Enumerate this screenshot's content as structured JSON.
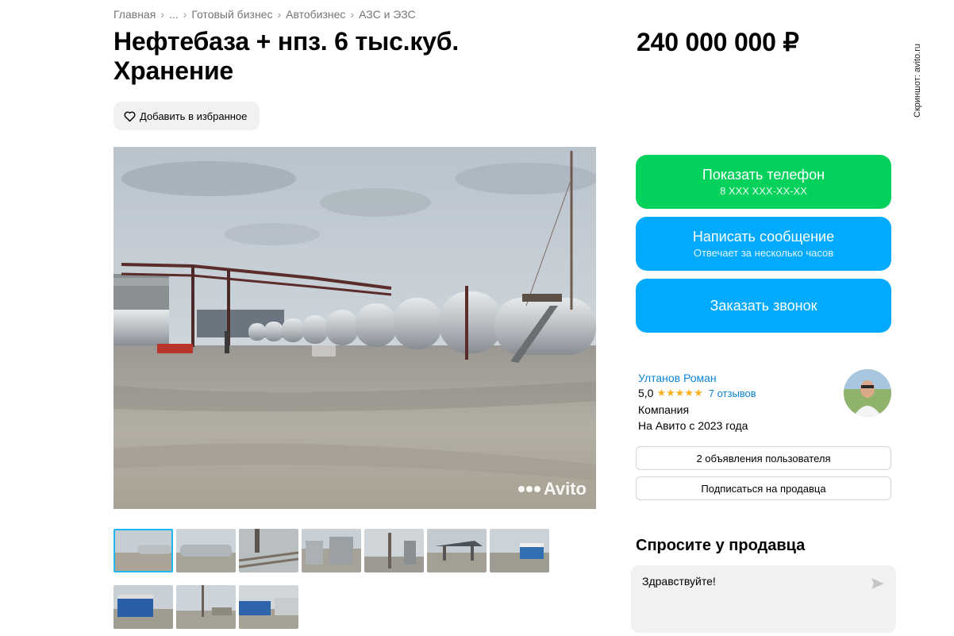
{
  "breadcrumb": {
    "items": [
      "Главная",
      "...",
      "Готовый бизнес",
      "Автобизнес",
      "АЗС и ЭЗС"
    ],
    "separator": "›"
  },
  "listing": {
    "title": "Нефтебаза + нпз. 6 тыс.куб. Хранение",
    "price": "240 000 000 ₽",
    "favorite_label": "Добавить в избранное"
  },
  "watermark": "Скриншот: avito.ru",
  "photo": {
    "logo_text": "Avito",
    "thumbnail_count": 10,
    "active_index": 0
  },
  "actions": {
    "show_phone": {
      "label": "Показать телефон",
      "sub": "8 XXX XXX-XX-XX"
    },
    "message": {
      "label": "Написать сообщение",
      "sub": "Отвечает за несколько часов"
    },
    "callback": {
      "label": "Заказать звонок"
    }
  },
  "seller": {
    "name": "Ултанов Роман",
    "rating": "5,0",
    "stars": "★★★★★",
    "reviews": "7 отзывов",
    "type": "Компания",
    "since": "На Авито с 2023 года",
    "listings_button": "2 объявления пользователя",
    "subscribe_button": "Подписаться на продавца"
  },
  "ask": {
    "title": "Спросите у продавца",
    "message": "Здравствуйте!"
  },
  "colors": {
    "green": "#02d15c",
    "blue": "#00aaff",
    "link": "#0a84d6",
    "star": "#ffb021",
    "thumb_active": "#1cb6f5"
  }
}
